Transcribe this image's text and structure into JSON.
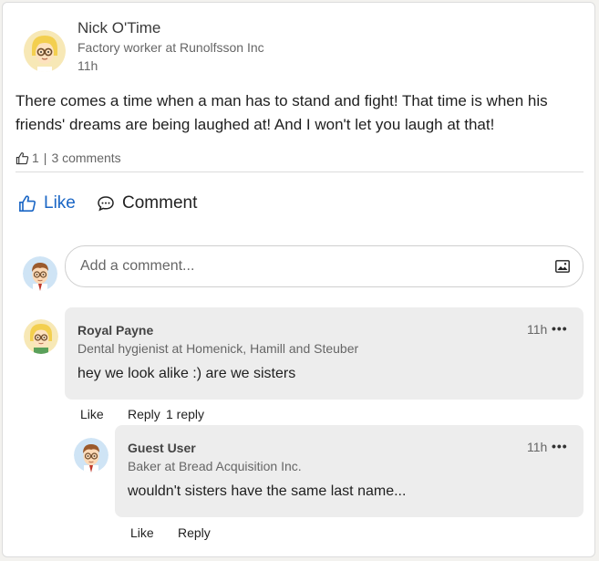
{
  "post": {
    "author_name": "Nick O'Time",
    "author_title": "Factory worker at Runolfsson Inc",
    "time": "11h",
    "text": "There comes a time when a man has to stand and fight! That time is when his friends' dreams are being laughed at! And I won't let you laugh at that!",
    "likes_count": "1",
    "separator": "|",
    "comments_count": "3 comments",
    "avatar_icon": "avatar-blonde-glasses-icon"
  },
  "actions": {
    "like_label": "Like",
    "comment_label": "Comment"
  },
  "composer": {
    "placeholder": "Add a comment...",
    "image_icon": "image-icon"
  },
  "comments": [
    {
      "author_name": "Royal Payne",
      "author_title": "Dental hygienist at Homenick, Hamill and Steuber",
      "time": "11h",
      "more": "•••",
      "text": "hey we look alike :) are we sisters",
      "like_label": "Like",
      "reply_label": "Reply",
      "reply_count": "1 reply"
    },
    {
      "author_name": "Guest User",
      "author_title": "Baker at Bread Acquisition Inc.",
      "time": "11h",
      "more": "•••",
      "text": "wouldn't sisters have the same last name...",
      "like_label": "Like",
      "reply_label": "Reply"
    }
  ],
  "colors": {
    "accent": "#1a66c5",
    "bubble": "#ededed"
  }
}
